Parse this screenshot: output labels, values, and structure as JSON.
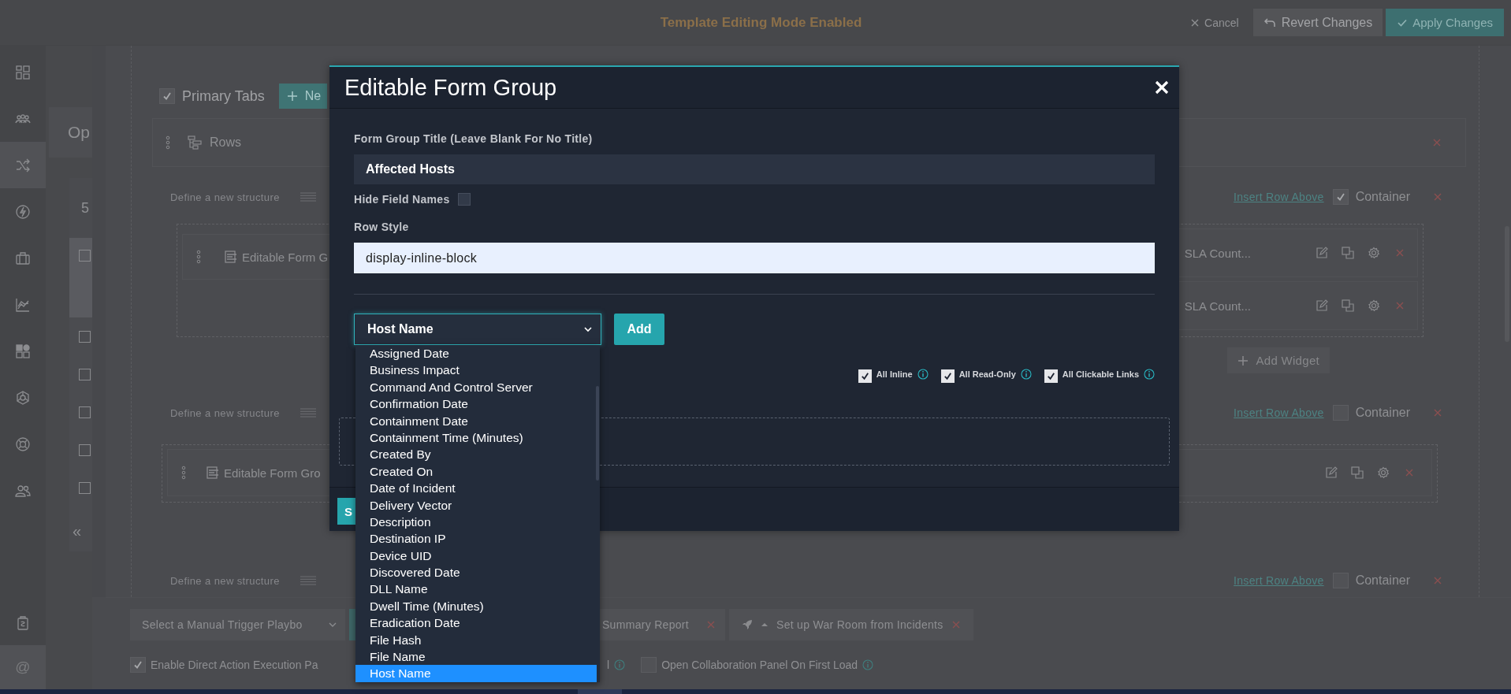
{
  "top_bar": {
    "title": "Template Editing Mode Enabled",
    "buttons": [
      {
        "kind": "cancel",
        "label": "Cancel"
      },
      {
        "kind": "revert",
        "label": "Revert Changes"
      },
      {
        "kind": "apply",
        "label": "Apply Changes"
      }
    ]
  },
  "nav_rail": {
    "items": [
      {
        "selected": false
      },
      {
        "selected": false
      },
      {
        "selected": true
      },
      {
        "selected": false
      },
      {
        "selected": false
      },
      {
        "selected": false
      },
      {
        "selected": false
      },
      {
        "selected": false
      },
      {
        "selected": false
      },
      {
        "selected": false
      }
    ],
    "bottom_items": [
      {
        "kind": "icon",
        "selected": false
      },
      {
        "kind": "text",
        "label": "@",
        "selected": true
      }
    ]
  },
  "side_panel": {
    "heading": "Op",
    "count": "5",
    "rows": [
      {
        "checked": false,
        "selected": true
      },
      {
        "checked": false,
        "selected": false
      },
      {
        "checked": false,
        "selected": false
      },
      {
        "checked": false,
        "selected": false
      },
      {
        "checked": false,
        "selected": false
      },
      {
        "checked": false,
        "selected": false
      }
    ],
    "collapse": "«"
  },
  "editor": {
    "tabs_toggle": {
      "label": "Primary Tabs",
      "checked": true
    },
    "new_button": "Ne",
    "rows_panel": {
      "title": "Rows"
    },
    "structures": [
      {
        "label": "Define a new structure",
        "insert_link": "Insert Row Above",
        "container": {
          "label": "Container",
          "checked": true
        },
        "columns": [
          [
            {
              "title": "Editable Form G"
            }
          ],
          [
            {
              "title": "SLA Count...",
              "actions": true
            },
            {
              "title": "SLA Count...",
              "actions": true
            }
          ]
        ],
        "add_widget": "Add Widget"
      },
      {
        "label": "Define a new structure",
        "insert_link": "Insert Row Above",
        "container": {
          "label": "Container",
          "checked": false
        },
        "columns": [
          [
            {
              "title": "Editable Form Gro",
              "actions": true
            }
          ]
        ]
      },
      {
        "label": "Define a new structure",
        "insert_link": "Insert Row Above",
        "container": {
          "label": "Container",
          "checked": false
        }
      }
    ]
  },
  "bottom_bar": {
    "playbook_select": "Select a Manual Trigger Playbo",
    "actions": [
      {
        "kind": "report",
        "label": "Summary Report"
      },
      {
        "kind": "war-room",
        "label": "Set up War Room from Incidents"
      }
    ],
    "options": [
      {
        "label": "Enable Direct Action Execution Pa",
        "checked": true
      },
      {
        "label": "Open Collaboration Panel On First Load",
        "checked": false
      }
    ],
    "cut_label": "l"
  },
  "modal": {
    "title": "Editable Form Group",
    "title_field": {
      "label": "Form Group Title (Leave Blank For No Title)",
      "value": "Affected Hosts"
    },
    "hide_field_names": {
      "label": "Hide Field Names",
      "checked": false
    },
    "row_style": {
      "label": "Row Style",
      "value": "display-inline-block"
    },
    "field_select": {
      "value": "Host Name",
      "options": [
        {
          "label": "Assigned Date",
          "selected": false
        },
        {
          "label": "Business Impact",
          "selected": false
        },
        {
          "label": "Command And Control Server",
          "selected": false
        },
        {
          "label": "Confirmation Date",
          "selected": false
        },
        {
          "label": "Containment Date",
          "selected": false
        },
        {
          "label": "Containment Time (Minutes)",
          "selected": false
        },
        {
          "label": "Created By",
          "selected": false
        },
        {
          "label": "Created On",
          "selected": false
        },
        {
          "label": "Date of Incident",
          "selected": false
        },
        {
          "label": "Delivery Vector",
          "selected": false
        },
        {
          "label": "Description",
          "selected": false
        },
        {
          "label": "Destination IP",
          "selected": false
        },
        {
          "label": "Device UID",
          "selected": false
        },
        {
          "label": "Discovered Date",
          "selected": false
        },
        {
          "label": "DLL Name",
          "selected": false
        },
        {
          "label": "Dwell Time (Minutes)",
          "selected": false
        },
        {
          "label": "Eradication Date",
          "selected": false
        },
        {
          "label": "File Hash",
          "selected": false
        },
        {
          "label": "File Name",
          "selected": false
        },
        {
          "label": "Host Name",
          "selected": true
        }
      ]
    },
    "add_button": "Add",
    "toggles": [
      {
        "label": "All Inline",
        "checked": true
      },
      {
        "label": "All Read-Only",
        "checked": true
      },
      {
        "label": "All Clickable Links",
        "checked": true
      }
    ],
    "save_button": "S"
  }
}
